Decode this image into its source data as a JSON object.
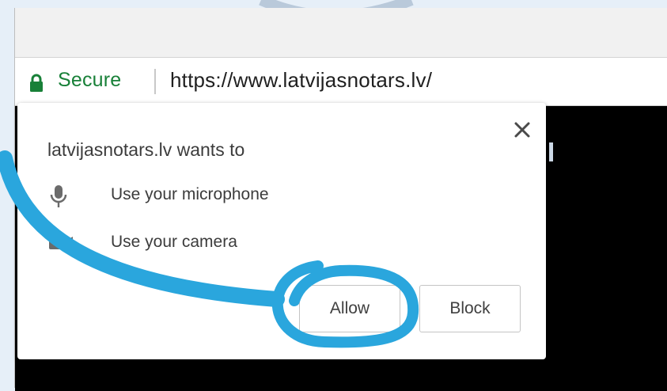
{
  "address_bar": {
    "security_label": "Secure",
    "url": "https://www.latvijasnotars.lv/"
  },
  "permission_prompt": {
    "title": "latvijasnotars.lv wants to",
    "permissions": [
      {
        "label": "Use your microphone",
        "icon": "microphone-icon"
      },
      {
        "label": "Use your camera",
        "icon": "camera-icon"
      }
    ],
    "allow_label": "Allow",
    "block_label": "Block"
  },
  "colors": {
    "secure_green": "#188038",
    "annotation_blue": "#2aa6dd",
    "page_background": "#e6eff8"
  }
}
